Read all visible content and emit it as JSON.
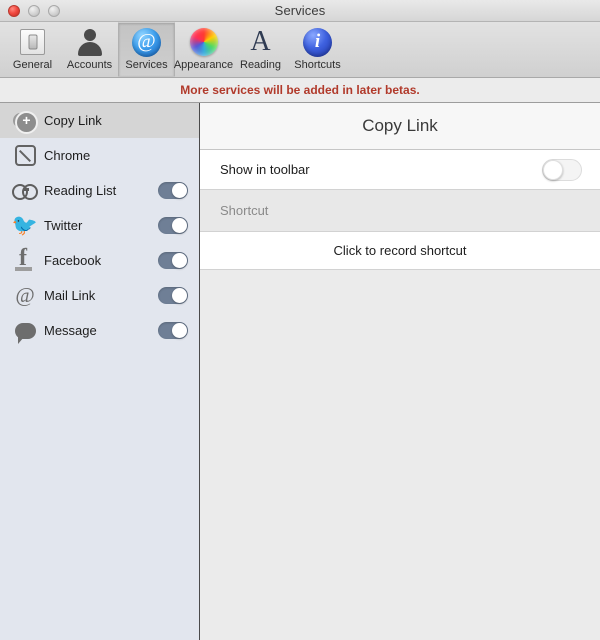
{
  "window": {
    "title": "Services",
    "traffic_lights": [
      "close",
      "minimize",
      "zoom"
    ]
  },
  "toolbar": {
    "items": [
      {
        "label": "General",
        "icon": "light-switch-icon",
        "selected": false
      },
      {
        "label": "Accounts",
        "icon": "person-silhouette-icon",
        "selected": false
      },
      {
        "label": "Services",
        "icon": "at-sign-circle-icon",
        "selected": true
      },
      {
        "label": "Appearance",
        "icon": "color-wheel-icon",
        "selected": false
      },
      {
        "label": "Reading",
        "icon": "letter-a-icon",
        "selected": false
      },
      {
        "label": "Shortcuts",
        "icon": "info-circle-icon",
        "selected": false
      }
    ]
  },
  "banner": {
    "text": "More services will be added in later betas.",
    "color": "#b13a2b"
  },
  "sidebar": {
    "items": [
      {
        "label": "Copy Link",
        "icon": "copy-link-icon",
        "selected": true,
        "has_toggle": false,
        "toggle_on": false
      },
      {
        "label": "Chrome",
        "icon": "chrome-compass-icon",
        "selected": false,
        "has_toggle": false,
        "toggle_on": false
      },
      {
        "label": "Reading List",
        "icon": "glasses-icon",
        "selected": false,
        "has_toggle": true,
        "toggle_on": true
      },
      {
        "label": "Twitter",
        "icon": "twitter-bird-icon",
        "selected": false,
        "has_toggle": true,
        "toggle_on": true
      },
      {
        "label": "Facebook",
        "icon": "facebook-f-icon",
        "selected": false,
        "has_toggle": true,
        "toggle_on": true
      },
      {
        "label": "Mail Link",
        "icon": "at-sign-icon",
        "selected": false,
        "has_toggle": true,
        "toggle_on": true
      },
      {
        "label": "Message",
        "icon": "speech-bubble-icon",
        "selected": false,
        "has_toggle": true,
        "toggle_on": true
      }
    ]
  },
  "detail": {
    "title": "Copy Link",
    "show_in_toolbar_label": "Show in toolbar",
    "show_in_toolbar_on": false,
    "shortcut_section_label": "Shortcut",
    "record_shortcut_label": "Click to record shortcut"
  },
  "colors": {
    "toggle_on": "#6f7f96",
    "sidebar_bg": "#e2e6ee",
    "content_bg": "#ebebeb",
    "banner_text": "#b13a2b"
  }
}
